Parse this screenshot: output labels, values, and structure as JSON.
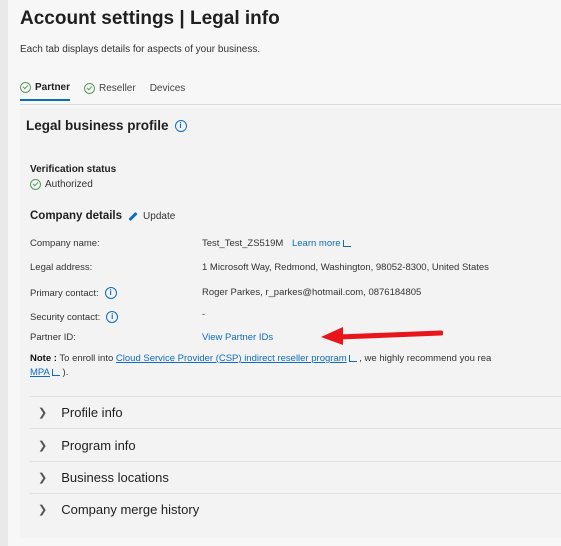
{
  "header": {
    "title": "Account settings | Legal info",
    "subtitle": "Each tab displays details for aspects of your business."
  },
  "tabs": [
    {
      "label": "Partner",
      "active": true
    },
    {
      "label": "Reseller",
      "active": false
    },
    {
      "label": "Devices",
      "active": false
    }
  ],
  "profile": {
    "section_title": "Legal business profile",
    "verification_label": "Verification status",
    "verification_value": "Authorized",
    "company_details_title": "Company details",
    "update_label": "Update"
  },
  "fields": {
    "company_name_label": "Company name:",
    "company_name_value": "Test_Test_ZS519M",
    "learn_more": "Learn more",
    "legal_address_label": "Legal address:",
    "legal_address_value": "1 Microsoft Way, Redmond, Washington, 98052-8300, United States",
    "primary_contact_label": "Primary contact:",
    "primary_contact_value": "Roger Parkes, r_parkes@hotmail.com, 0876184805",
    "security_contact_label": "Security contact:",
    "security_contact_value": "-",
    "partner_id_label": "Partner ID:",
    "partner_id_link": "View Partner IDs"
  },
  "note": {
    "prefix": "Note :",
    "text1": " To enroll into ",
    "link": "Cloud Service Provider (CSP) indirect reseller program",
    "text2": " , we highly recommend you rea",
    "mpa": "MPA",
    "tail": " )."
  },
  "accordion": [
    "Profile info",
    "Program info",
    "Business locations",
    "Company merge history"
  ],
  "colors": {
    "accent": "#0f6cbd",
    "arrow": "#e8151b",
    "success": "#5b9b5b"
  }
}
